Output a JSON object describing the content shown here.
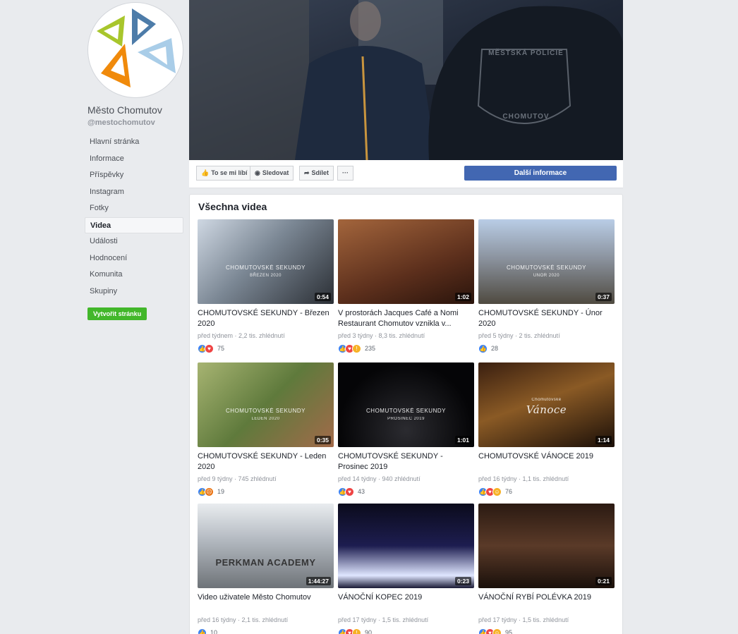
{
  "page": {
    "name": "Město Chomutov",
    "handle": "@mestochomutov"
  },
  "nav": [
    {
      "label": "Hlavní stránka",
      "active": false
    },
    {
      "label": "Informace",
      "active": false
    },
    {
      "label": "Příspěvky",
      "active": false
    },
    {
      "label": "Instagram",
      "active": false
    },
    {
      "label": "Fotky",
      "active": false
    },
    {
      "label": "Videa",
      "active": true
    },
    {
      "label": "Události",
      "active": false
    },
    {
      "label": "Hodnocení",
      "active": false
    },
    {
      "label": "Komunita",
      "active": false
    },
    {
      "label": "Skupiny",
      "active": false
    }
  ],
  "create_page_label": "Vytvořit stránku",
  "cover_actions": {
    "like": "To se mi líbí",
    "follow": "Sledovat",
    "share": "Sdílet",
    "more": "···",
    "more_info": "Další informace"
  },
  "videos_title": "Všechna videa",
  "videos": [
    {
      "title": "CHOMUTOVSKÉ SEKUNDY - Březen 2020",
      "meta": "před týdnem · 2,2 tis. zhlédnutí",
      "duration": "0:54",
      "count": "75",
      "reactions": [
        "like",
        "love"
      ],
      "overlay": "CHOMUTOVSKÉ SEKUNDY",
      "overlay_sub": "BŘEZEN 2020"
    },
    {
      "title": "V prostorách Jacques Café a Nomi Restaurant Chomutov vznikla v...",
      "meta": "před 3 týdny · 8,3 tis. zhlédnutí",
      "duration": "1:02",
      "count": "235",
      "reactions": [
        "like",
        "love",
        "wow"
      ],
      "overlay": "",
      "overlay_sub": ""
    },
    {
      "title": "CHOMUTOVSKÉ SEKUNDY - Únor 2020",
      "meta": "před 5 týdny · 2 tis. zhlédnutí",
      "duration": "0:37",
      "count": "28",
      "reactions": [
        "like"
      ],
      "overlay": "CHOMUTOVSKÉ SEKUNDY",
      "overlay_sub": "ÚNOR 2020"
    },
    {
      "title": "CHOMUTOVSKÉ SEKUNDY - Leden 2020",
      "meta": "před 9 týdny · 745 zhlédnutí",
      "duration": "0:35",
      "count": "19",
      "reactions": [
        "like",
        "angry"
      ],
      "overlay": "CHOMUTOVSKÉ SEKUNDY",
      "overlay_sub": "LEDEN 2020"
    },
    {
      "title": "CHOMUTOVSKÉ SEKUNDY - Prosinec 2019",
      "meta": "před 14 týdny · 940 zhlédnutí",
      "duration": "1:01",
      "count": "43",
      "reactions": [
        "like",
        "love"
      ],
      "overlay": "CHOMUTOVSKÉ SEKUNDY",
      "overlay_sub": "PROSINEC 2019"
    },
    {
      "title": "CHOMUTOVSKÉ VÁNOCE 2019",
      "meta": "před 16 týdny · 1,1 tis. zhlédnutí",
      "duration": "1:14",
      "count": "76",
      "reactions": [
        "like",
        "love",
        "haha"
      ],
      "overlay": "Vánoce",
      "overlay_sub": "Chomutovské"
    },
    {
      "title": "Video uživatele Město Chomutov",
      "meta": "před 16 týdny · 2,1 tis. zhlédnutí",
      "duration": "1:44:27",
      "count": "10",
      "reactions": [
        "like"
      ],
      "overlay": "PERKMAN ACADEMY",
      "overlay_sub": ""
    },
    {
      "title": "VÁNOČNÍ KOPEC 2019",
      "meta": "před 17 týdny · 1,5 tis. zhlédnutí",
      "duration": "0:23",
      "count": "90",
      "reactions": [
        "like",
        "love",
        "wow"
      ],
      "overlay": "",
      "overlay_sub": ""
    },
    {
      "title": "VÁNOČNÍ RYBÍ POLÉVKA 2019",
      "meta": "před 17 týdny · 1,5 tis. zhlédnutí",
      "duration": "0:21",
      "count": "95",
      "reactions": [
        "like",
        "love",
        "haha"
      ],
      "overlay": "",
      "overlay_sub": ""
    }
  ],
  "cover_badge": {
    "top": "MĚSTSKÁ POLICIE",
    "bottom": "CHOMUTOV"
  }
}
